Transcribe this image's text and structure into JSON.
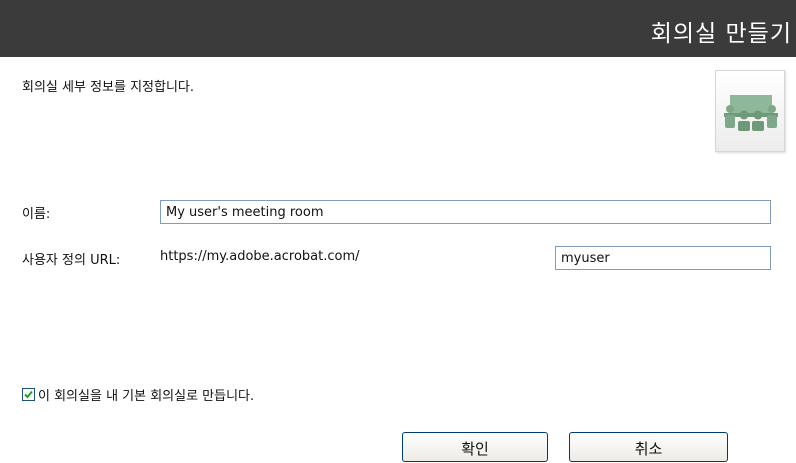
{
  "header": {
    "title": "회의실 만들기"
  },
  "instructions": "회의실 세부 정보를 지정합니다.",
  "icon": {
    "name": "meeting-room-icon",
    "color": "#7fa88a"
  },
  "form": {
    "name_label": "이름:",
    "name_value": "My user's meeting room",
    "url_label": "사용자 정의 URL:",
    "url_prefix": "https://my.adobe.acrobat.com/",
    "url_value": "myuser"
  },
  "default_room": {
    "checked": true,
    "label": "이 회의실을 내 기본 회의실로 만듭니다."
  },
  "buttons": {
    "ok_label": "확인",
    "cancel_label": "취소"
  },
  "colors": {
    "header_bg": "#3b3b3b",
    "header_text": "#ffffff",
    "input_border": "#7f9db9",
    "button_border": "#003c74"
  }
}
